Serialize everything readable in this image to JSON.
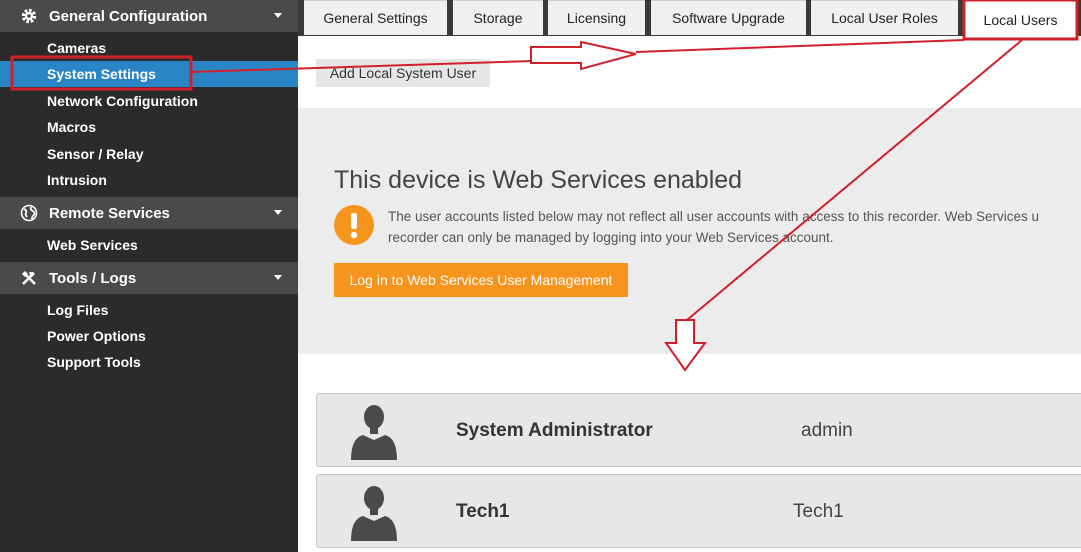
{
  "sidebar": {
    "sections": [
      {
        "title": "General Configuration",
        "icon": "gear-icon",
        "items": [
          "Cameras",
          "System Settings",
          "Network Configuration",
          "Macros",
          "Sensor / Relay",
          "Intrusion"
        ]
      },
      {
        "title": "Remote Services",
        "icon": "globe-icon",
        "items": [
          "Web Services"
        ]
      },
      {
        "title": "Tools / Logs",
        "icon": "tools-icon",
        "items": [
          "Log Files",
          "Power Options",
          "Support Tools"
        ]
      }
    ],
    "active_item": "System Settings"
  },
  "tabs": [
    "General Settings",
    "Storage",
    "Licensing",
    "Software Upgrade",
    "Local User Roles",
    "Local Users"
  ],
  "active_tab": "Local Users",
  "main": {
    "add_button": "Add Local System User",
    "web_services": {
      "title": "This device is Web Services enabled",
      "message_line1": "The user accounts listed below may not reflect all user accounts with access to this recorder. Web Services u",
      "message_line2": "recorder can only be managed by logging into your Web Services account.",
      "login_button": "Log in to Web Services User Management"
    },
    "users": [
      {
        "name": "System Administrator",
        "login": "admin"
      },
      {
        "name": "Tech1",
        "login": "Tech1"
      }
    ]
  },
  "colors": {
    "sidebar_bg": "#2b2b2b",
    "section_header_bg": "#4a4a4a",
    "active_item": "#2a85c7",
    "orange": "#f7941e",
    "annotation_red": "#d0202a"
  }
}
